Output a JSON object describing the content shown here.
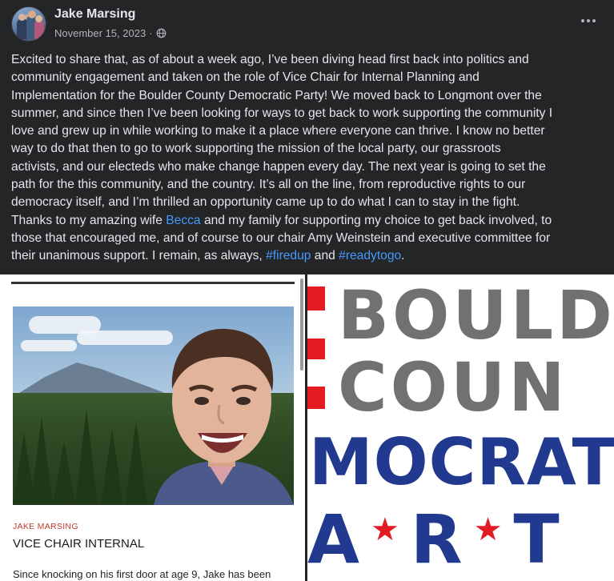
{
  "post": {
    "author": "Jake Marsing",
    "date": "November 15, 2023",
    "separator": "·",
    "text_lines": [
      [
        {
          "t": "Excited to share that, as of about a week ago, I’ve been diving head first back into politics and"
        }
      ],
      [
        {
          "t": "community engagement and taken on the role of Vice Chair for Internal Planning and"
        }
      ],
      [
        {
          "t": "Implementation for the Boulder County Democratic Party! We moved back to Longmont over the"
        }
      ],
      [
        {
          "t": "summer, and since then I’ve been looking for ways to get back to work supporting the community I"
        }
      ],
      [
        {
          "t": "love and grew up in while working to make it a place where everyone can thrive. I know no better"
        }
      ],
      [
        {
          "t": "way to do that then to go to work supporting the mission of the local party, our grassroots"
        }
      ],
      [
        {
          "t": "activists, and our electeds who make change happen every day. The next year is going to set the"
        }
      ],
      [
        {
          "t": "path for the this community, and the country. It’s all on the line, from reproductive rights to our"
        }
      ],
      [
        {
          "t": "democracy itself, and I’m thrilled an opportunity came up to do what I can to stay in the fight."
        }
      ],
      [
        {
          "t": "Thanks to my amazing wife "
        },
        {
          "t": "Becca",
          "link": true
        },
        {
          "t": " and my family for supporting my choice to get back involved, to"
        }
      ],
      [
        {
          "t": "those that encouraged me, and of course to our chair Amy Weinstein and executive committee for"
        }
      ],
      [
        {
          "t": "their unanimous support. I remain, as always, "
        },
        {
          "t": "#firedup",
          "link": true
        },
        {
          "t": " and "
        },
        {
          "t": "#readytogo",
          "link": true
        },
        {
          "t": "."
        }
      ]
    ]
  },
  "profile_card": {
    "name": "JAKE MARSING",
    "role": "VICE CHAIR INTERNAL",
    "bio": "Since knocking on his first door at age 9, Jake has been"
  },
  "logo": {
    "line1": "BOULD",
    "line2": "COUN",
    "line3": "MOCRAT",
    "line4": [
      "A",
      "R",
      "T"
    ],
    "star": "★"
  },
  "icons": {
    "privacy": "globe-icon",
    "menu": "more-options-icon"
  },
  "colors": {
    "background": "#242526",
    "text": "#e4e6eb",
    "muted": "#b0b3b8",
    "link": "#4599ff",
    "logo_red": "#e31b23",
    "logo_navy": "#213a8f",
    "logo_gray": "#707173"
  }
}
